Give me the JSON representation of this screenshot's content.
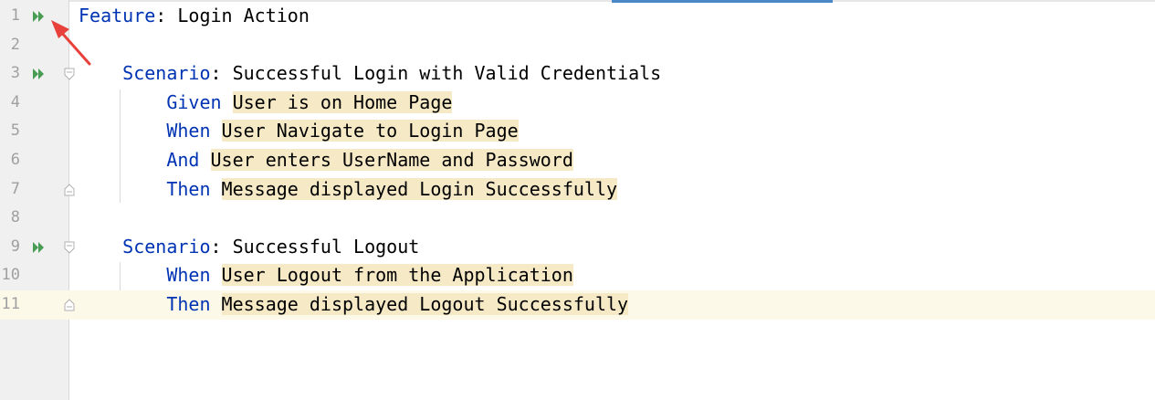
{
  "editor": {
    "lines": [
      {
        "num": "1"
      },
      {
        "num": "2"
      },
      {
        "num": "3"
      },
      {
        "num": "4"
      },
      {
        "num": "5"
      },
      {
        "num": "6"
      },
      {
        "num": "7"
      },
      {
        "num": "8"
      },
      {
        "num": "9"
      },
      {
        "num": "10"
      },
      {
        "num": "11"
      }
    ],
    "feature": {
      "keyword": "Feature",
      "separator": ": ",
      "name": "Login Action"
    },
    "scenario1": {
      "keyword": "Scenario",
      "separator": ": ",
      "name": "Successful Login with Valid Credentials",
      "steps": [
        {
          "keyword": "Given",
          "text": "User is on Home Page"
        },
        {
          "keyword": "When",
          "text": "User Navigate to Login Page"
        },
        {
          "keyword": "And",
          "text": "User enters UserName and Password"
        },
        {
          "keyword": "Then",
          "text": "Message displayed Login Successfully"
        }
      ]
    },
    "scenario2": {
      "keyword": "Scenario",
      "separator": ": ",
      "name": "Successful Logout",
      "steps": [
        {
          "keyword": "When",
          "text": "User Logout from the Application"
        },
        {
          "keyword": "Then",
          "text": "Message displayed Logout Successfully"
        }
      ]
    },
    "icons": {
      "run": "run-double-arrow-icon",
      "fold": "fold-marker-icon",
      "annotation": "red-arrow-icon"
    },
    "colors": {
      "keyword": "#0033b3",
      "step_highlight": "#f6e9c5",
      "current_line": "#fcf9e8",
      "run_icon": "#499c54",
      "annotation_arrow": "#e8413c"
    }
  }
}
